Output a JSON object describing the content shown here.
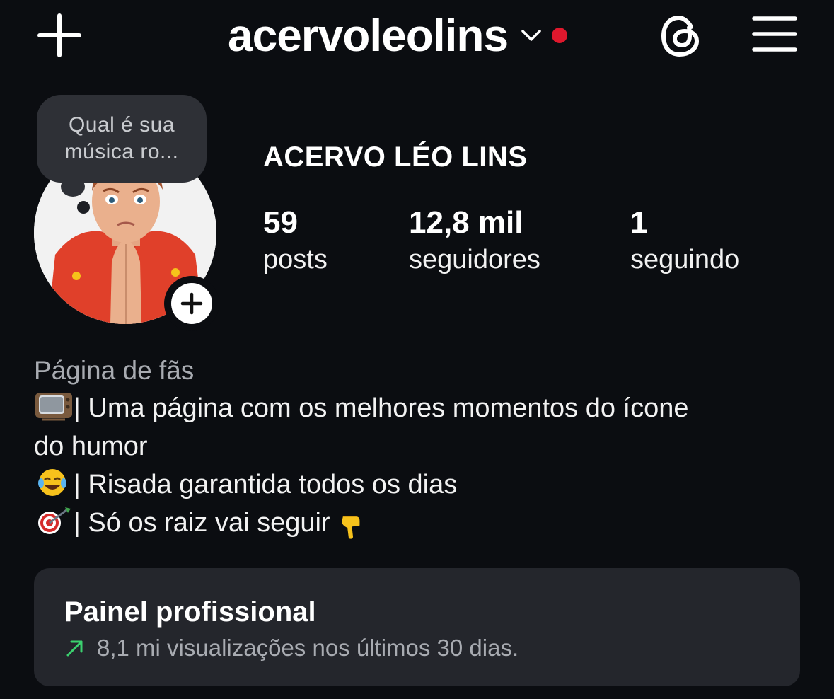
{
  "header": {
    "username": "acervoleolins",
    "notification_dot_color": "#e0182d"
  },
  "profile": {
    "note": "Qual é sua\nmúsica ro...",
    "display_name": "ACERVO LÉO LINS",
    "stats": [
      {
        "value": "59",
        "label": "posts"
      },
      {
        "value": "12,8 mil",
        "label": "seguidores"
      },
      {
        "value": "1",
        "label": "seguindo"
      }
    ]
  },
  "bio": {
    "category": "Página de fãs",
    "lines": [
      {
        "emoji": "tv-emoji",
        "text": "| Uma página com os melhores momentos do ícone"
      },
      {
        "emoji": "",
        "text": "do humor"
      },
      {
        "emoji": "laughing-emoji",
        "text": "| Risada garantida todos os dias"
      },
      {
        "emoji": "target-emoji",
        "text": "| Só os raiz vai seguir "
      }
    ],
    "trailing_emoji": "pointing-down-emoji"
  },
  "dashboard": {
    "title": "Painel profissional",
    "subtitle": "8,1 mi visualizações nos últimos 30 dias.",
    "trend_color": "#3bd16f"
  },
  "icons": {
    "new_post": "plus-icon",
    "switch_account": "chevron-down-icon",
    "threads": "threads-icon",
    "menu": "hamburger-menu-icon",
    "add_story": "plus-icon"
  }
}
